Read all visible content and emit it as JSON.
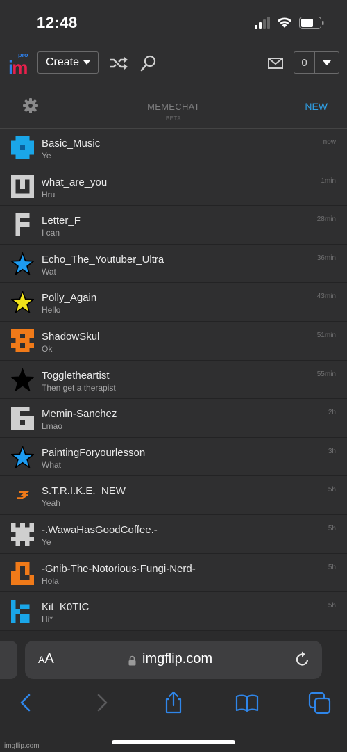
{
  "status": {
    "time": "12:48"
  },
  "nav": {
    "logo_main": "im",
    "logo_pro": "pro",
    "create_label": "Create",
    "notif_count": "0"
  },
  "chat": {
    "title": "MEMECHAT",
    "subtitle": "BETA",
    "new_label": "NEW"
  },
  "conversations": [
    {
      "name": "Basic_Music",
      "message": "Ye",
      "time": "now",
      "avatar_icon": "blue-pixel-ring-icon"
    },
    {
      "name": "what_are_you",
      "message": "Hru",
      "time": "1min",
      "avatar_icon": "gray-pixel-u-icon"
    },
    {
      "name": "Letter_F",
      "message": "I can",
      "time": "28min",
      "avatar_icon": "gray-pixel-f-icon"
    },
    {
      "name": "Echo_The_Youtuber_Ultra",
      "message": "Wat",
      "time": "36min",
      "avatar_icon": "blue-star-icon"
    },
    {
      "name": "Polly_Again",
      "message": "Hello",
      "time": "43min",
      "avatar_icon": "yellow-star-icon"
    },
    {
      "name": "ShadowSkul",
      "message": "Ok",
      "time": "51min",
      "avatar_icon": "orange-pixel-icon"
    },
    {
      "name": "Toggletheartist",
      "message": "Then get a therapist",
      "time": "55min",
      "avatar_icon": "black-star-icon"
    },
    {
      "name": "Memin-Sanchez",
      "message": "Lmao",
      "time": "2h",
      "avatar_icon": "gray-pixel-g-icon"
    },
    {
      "name": "PaintingForyourlesson",
      "message": "What",
      "time": "3h",
      "avatar_icon": "blue-star-icon"
    },
    {
      "name": "S.T.R.I.K.E._NEW",
      "message": "Yeah",
      "time": "5h",
      "avatar_icon": "orange-bolt-icon"
    },
    {
      "name": "-.WawaHasGoodCoffee.-",
      "message": "Ye",
      "time": "5h",
      "avatar_icon": "gray-pixel-pattern-icon"
    },
    {
      "name": "-Gnib-The-Notorious-Fungi-Nerd-",
      "message": "Hola",
      "time": "5h",
      "avatar_icon": "orange-pixel-2-icon"
    },
    {
      "name": "Kit_K0TIC",
      "message": "Hi*",
      "time": "5h",
      "avatar_icon": "blue-pixel-k-icon"
    }
  ],
  "browser": {
    "aa_label_small": "A",
    "aa_label_big": "A",
    "url": "imgflip.com"
  },
  "watermark": "imgflip.com",
  "colors": {
    "background": "#2f2f30",
    "accent_blue": "#2fa0e6",
    "logo_blue": "#2d7ee6",
    "logo_red": "#e8204c",
    "avatar_orange": "#f07a19"
  }
}
